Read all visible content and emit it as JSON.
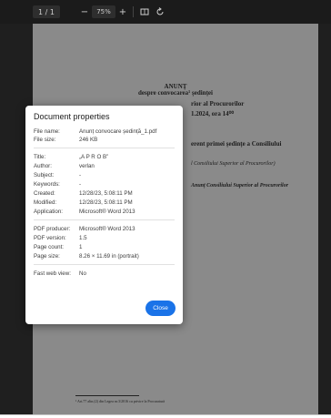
{
  "toolbar": {
    "page_indicator": "1 / 1",
    "zoom_out": "−",
    "zoom_level": "75%",
    "zoom_in": "+",
    "fit_icon": "fit-to-page-icon",
    "rotate_icon": "rotate-icon"
  },
  "document": {
    "heading": "ANUNȚ",
    "subheading": "despre convocarea¹ ședinței",
    "line_superior": "rior al Procurorilor",
    "line_date": "1.2024, ora 14⁰⁰",
    "line_curent": "erent primei ședințe a Consiliului",
    "line_italic1": "l Consiliului Superior al Procurorilor)",
    "line_italic2": "Anunț Consiliului Superior al Procurorilor",
    "footnote": "¹ Art.77 alin.(2) din Legea nr.3/2016 cu privire la Procuratură"
  },
  "dialog": {
    "title": "Document properties",
    "rows": [
      {
        "label": "File name:",
        "value": "Anunț convocare ședință_1.pdf"
      },
      {
        "label": "File size:",
        "value": "246 KB"
      },
      {
        "label": "Title:",
        "value": "„A P R O B”"
      },
      {
        "label": "Author:",
        "value": "verlan"
      },
      {
        "label": "Subject:",
        "value": "-"
      },
      {
        "label": "Keywords:",
        "value": "-"
      },
      {
        "label": "Created:",
        "value": "12/28/23, 5:08:11 PM"
      },
      {
        "label": "Modified:",
        "value": "12/28/23, 5:08:11 PM"
      },
      {
        "label": "Application:",
        "value": "Microsoft® Word 2013"
      },
      {
        "label": "PDF producer:",
        "value": "Microsoft® Word 2013"
      },
      {
        "label": "PDF version:",
        "value": "1.5"
      },
      {
        "label": "Page count:",
        "value": "1"
      },
      {
        "label": "Page size:",
        "value": "8.26 × 11.69 in (portrait)"
      },
      {
        "label": "Fast web view:",
        "value": "No"
      }
    ],
    "close_label": "Close"
  },
  "colors": {
    "viewer_bg": "#1f1f1f",
    "page_dimmed": "#8a8a8a",
    "accent": "#1a73e8"
  }
}
